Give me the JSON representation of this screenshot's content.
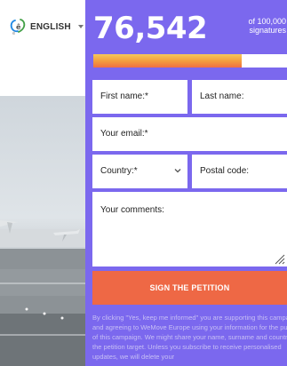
{
  "language": {
    "label": "ENGLISH",
    "icon": "language-icon"
  },
  "petition": {
    "signature_count": "76,542",
    "goal_prefix": "of 100,000",
    "goal_suffix": "signatures",
    "progress_fraction": 0.76542
  },
  "form": {
    "first_name": "First name:*",
    "last_name": "Last name:",
    "email": "Your email:*",
    "country": "Country:*",
    "postal_code": "Postal code:",
    "comments": "Your comments:",
    "sign_button": "SIGN THE PETITION"
  },
  "disclaimer": "By clicking \"Yes, keep me informed\" you are supporting this campaign, and agreeing to WeMove Europe using your information for the purpose of this campaign. We might share your name, surname and country with the petition target. Unless you subscribe to receive personalised updates, we will delete your",
  "colors": {
    "panel": "#7b68ee",
    "button": "#ee6845",
    "progress_start": "#f5c85a",
    "progress_end": "#ef6f43"
  }
}
